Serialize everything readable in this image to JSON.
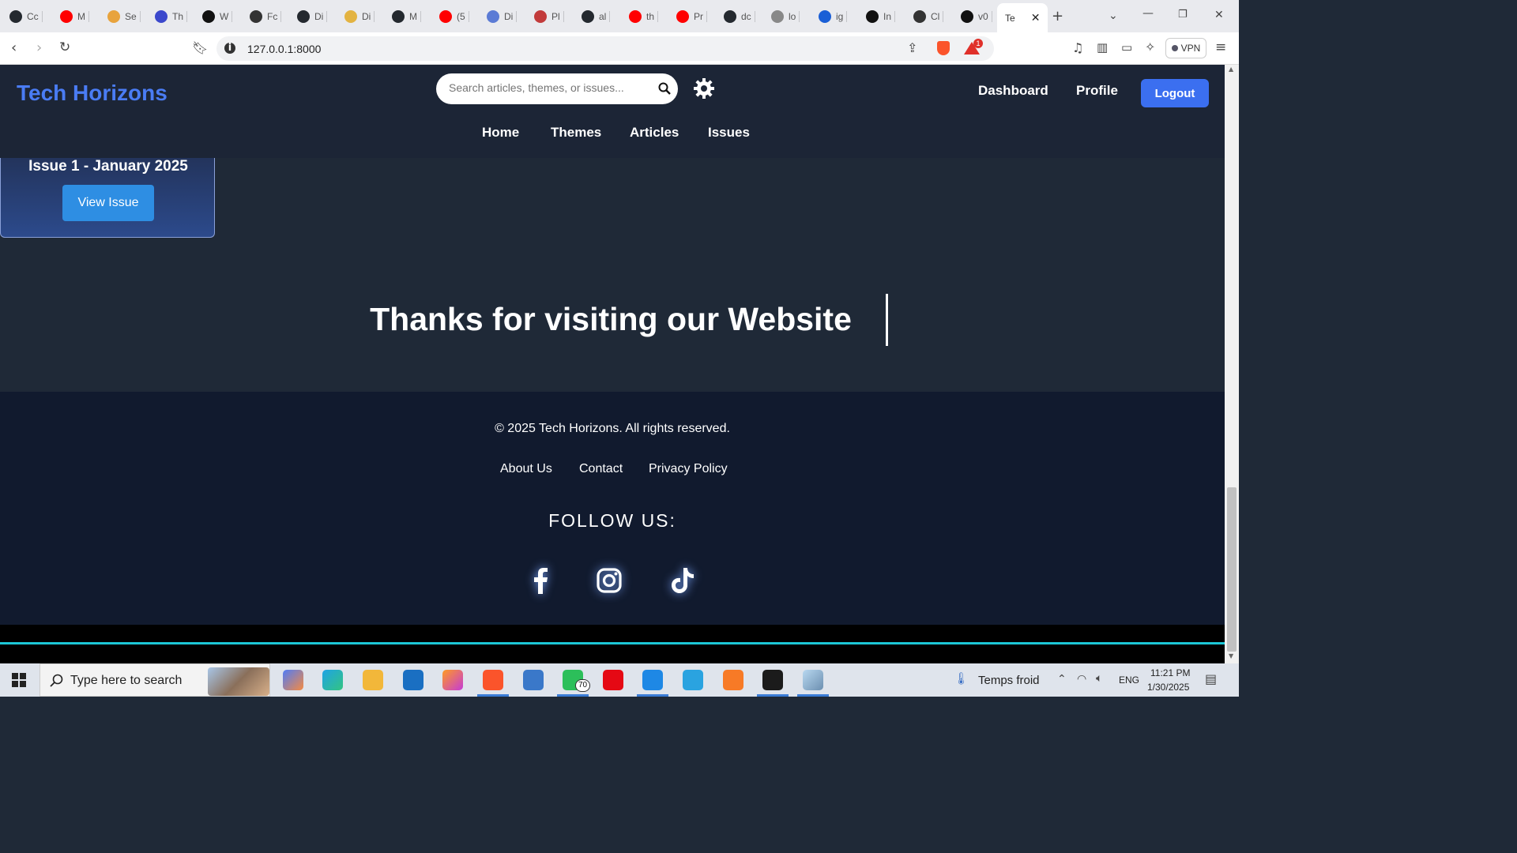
{
  "browser": {
    "tabs": [
      {
        "label": "Cc",
        "color": "#24292f"
      },
      {
        "label": "M",
        "color": "#ff0000"
      },
      {
        "label": "Se",
        "color": "#e8a33d"
      },
      {
        "label": "Th",
        "color": "#3b48cc"
      },
      {
        "label": "W",
        "color": "#111111"
      },
      {
        "label": "Fc",
        "color": "#333333"
      },
      {
        "label": "Di",
        "color": "#24292f"
      },
      {
        "label": "Di",
        "color": "#e3b341"
      },
      {
        "label": "M",
        "color": "#24292f"
      },
      {
        "label": "(5",
        "color": "#ff0000"
      },
      {
        "label": "Di",
        "color": "#5b7bd5"
      },
      {
        "label": "Pl",
        "color": "#c23b3b"
      },
      {
        "label": "al",
        "color": "#24292f"
      },
      {
        "label": "th",
        "color": "#ff0000"
      },
      {
        "label": "Pr",
        "color": "#ff0000"
      },
      {
        "label": "dc",
        "color": "#24292f"
      },
      {
        "label": "lo",
        "color": "#888888"
      },
      {
        "label": "ig",
        "color": "#1a5fd6"
      },
      {
        "label": "In",
        "color": "#111111"
      },
      {
        "label": "Cl",
        "color": "#333333"
      },
      {
        "label": "v0",
        "color": "#111111"
      }
    ],
    "active_tab": "Te",
    "url": "127.0.0.1:8000",
    "vpn_label": "VPN",
    "notif_count": "1"
  },
  "site": {
    "logo": "Tech Horizons",
    "search_placeholder": "Search articles, themes, or issues...",
    "nav_right": [
      "Dashboard",
      "Profile"
    ],
    "logout": "Logout",
    "nav_main": [
      "Home",
      "Themes",
      "Articles",
      "Issues"
    ]
  },
  "issue_card": {
    "title": "Issue 1 - January 2025",
    "button": "View Issue"
  },
  "thanks_text": "Thanks for visiting our Website",
  "footer": {
    "copyright": "© 2025 Tech Horizons. All rights reserved.",
    "links": [
      "About Us",
      "Contact",
      "Privacy Policy"
    ],
    "follow": "FOLLOW US:",
    "social_icons": [
      "facebook-icon",
      "instagram-icon",
      "tiktok-icon"
    ]
  },
  "taskbar": {
    "search_placeholder": "Type here to search",
    "whatsapp_badge": "70",
    "weather": "Temps froid",
    "lang": "ENG",
    "time": "11:21 PM",
    "date": "1/30/2025"
  }
}
